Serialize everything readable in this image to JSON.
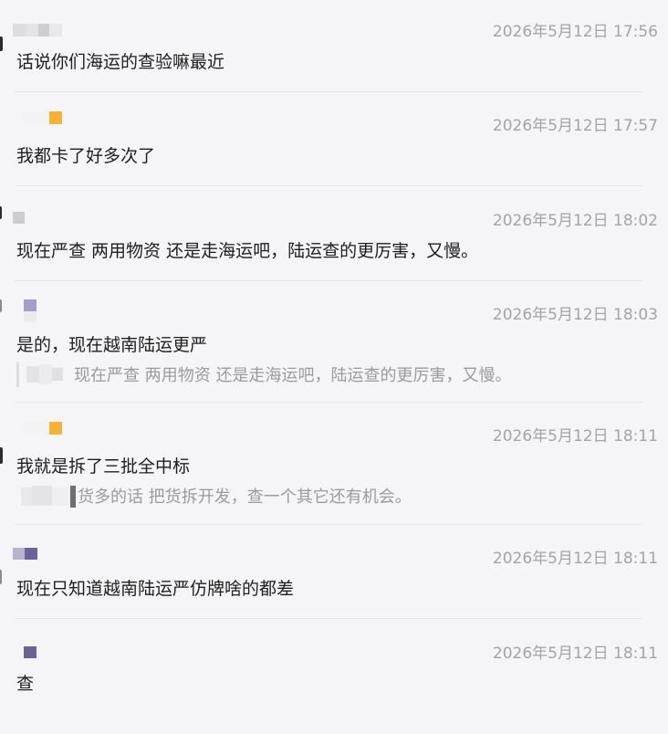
{
  "messages": [
    {
      "time": "2026年5月12日 17:56",
      "text": "话说你们海运的查验嘛最近"
    },
    {
      "time": "2026年5月12日 17:57",
      "text": "我都卡了好多次了"
    },
    {
      "time": "2026年5月12日 18:02",
      "text": "现在严查  两用物资  还是走海运吧，陆运查的更厉害，又慢。"
    },
    {
      "time": "2026年5月12日 18:03",
      "text": "是的，现在越南陆运更严",
      "quote": {
        "text": "现在严查  两用物资  还是走海运吧，陆运查的更厉害，又慢。"
      }
    },
    {
      "time": "2026年5月12日 18:11",
      "text": "我就是拆了三批全中标",
      "quote": {
        "text": "货多的话 把货拆开发，查一个其它还有机会。"
      }
    },
    {
      "time": "2026年5月12日 18:11",
      "text": "现在只知道越南陆运严仿牌啥的都差"
    },
    {
      "time": "2026年5月12日 18:11",
      "text": "查"
    }
  ],
  "colors": {
    "background": "#f5f5f7",
    "text": "#1e1e1e",
    "timestamp": "#a3a3a8",
    "quote_text": "#9a9aa0",
    "orange_block": "#f6b234",
    "purple_block": "#6b6298",
    "lavender_block": "#a59ec6"
  }
}
